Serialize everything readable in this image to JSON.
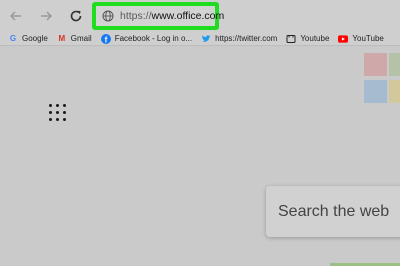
{
  "address_bar": {
    "url_prefix": "https://",
    "url_domain": "www.office.com",
    "highlight_color": "#1fdc1f"
  },
  "nav": {
    "back_icon": "arrow-left-icon",
    "forward_icon": "arrow-right-icon",
    "reload_icon": "reload-icon"
  },
  "bookmarks": [
    {
      "label": "Google",
      "icon": "google-icon"
    },
    {
      "label": "Gmail",
      "icon": "gmail-icon"
    },
    {
      "label": "Facebook - Log in o...",
      "icon": "facebook-icon"
    },
    {
      "label": "https://twitter.com",
      "icon": "twitter-icon"
    },
    {
      "label": "Youtube",
      "icon": "youtube-generic-icon"
    },
    {
      "label": "YouTube",
      "icon": "youtube-icon"
    }
  ],
  "page": {
    "search_placeholder": "Search the web",
    "app_launcher_icon": "app-launcher-icon",
    "tile_colors": [
      "#cfa9a9",
      "#b5c2a7",
      "#a6bad0",
      "#d3c79c"
    ]
  }
}
